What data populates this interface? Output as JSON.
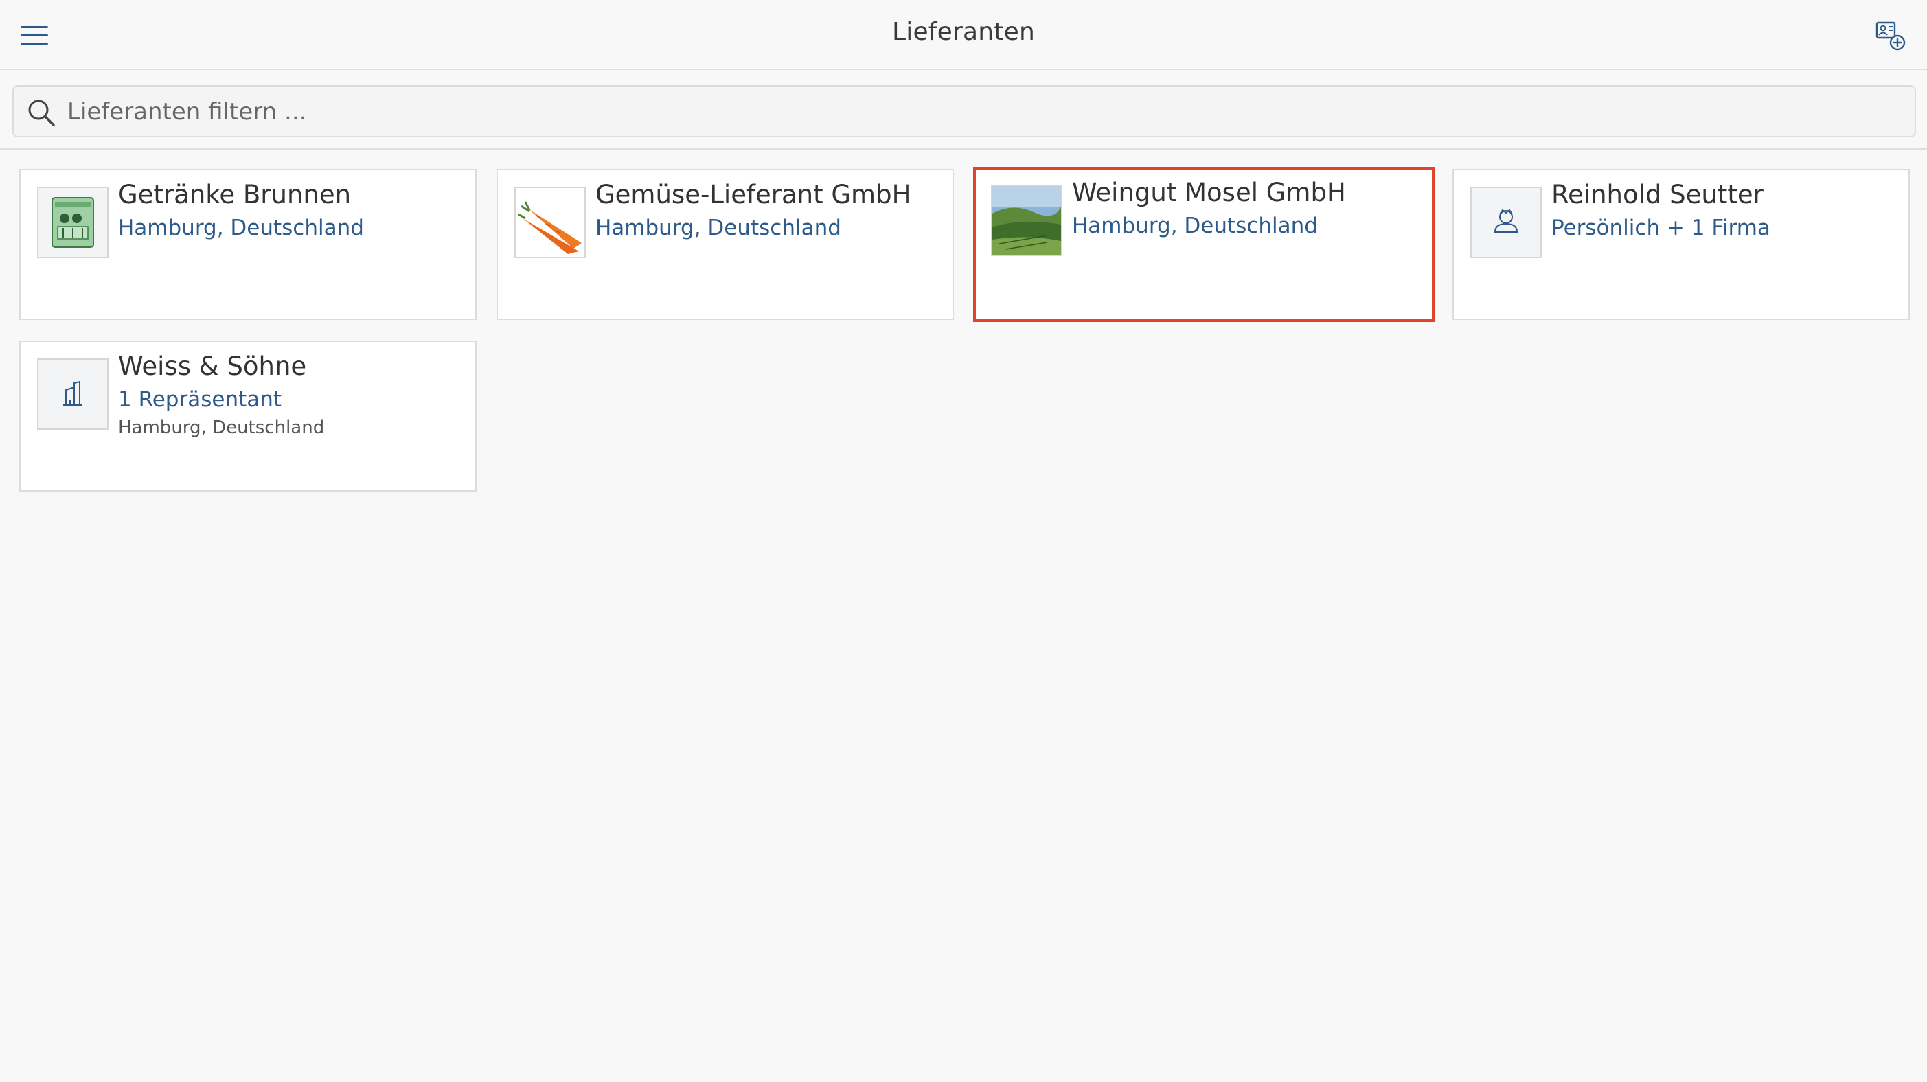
{
  "header": {
    "title": "Lieferanten",
    "menu_icon": "hamburger-menu-icon",
    "add_icon": "add-contact-icon"
  },
  "search": {
    "placeholder": "Lieferanten filtern ...",
    "value": ""
  },
  "colors": {
    "accent": "#2e5a8a",
    "selection": "#e0432c",
    "background": "#f8f8f8"
  },
  "suppliers": [
    {
      "name": "Getränke Brunnen",
      "subtitle": "Hamburg, Deutschland",
      "icon": "beverage-crate-image",
      "selected": false
    },
    {
      "name": "Gemüse-Lieferant GmbH",
      "subtitle": "Hamburg, Deutschland",
      "icon": "carrots-image",
      "selected": false
    },
    {
      "name": "Weingut Mosel GmbH",
      "subtitle": "Hamburg, Deutschland",
      "icon": "vineyard-image",
      "selected": true
    },
    {
      "name": "Reinhold Seutter",
      "subtitle": "Persönlich + 1 Firma",
      "icon": "person-icon",
      "selected": false
    },
    {
      "name": "Weiss & Söhne",
      "subtitle": "1 Repräsentant",
      "detail": "Hamburg, Deutschland",
      "icon": "building-icon",
      "selected": false
    }
  ]
}
